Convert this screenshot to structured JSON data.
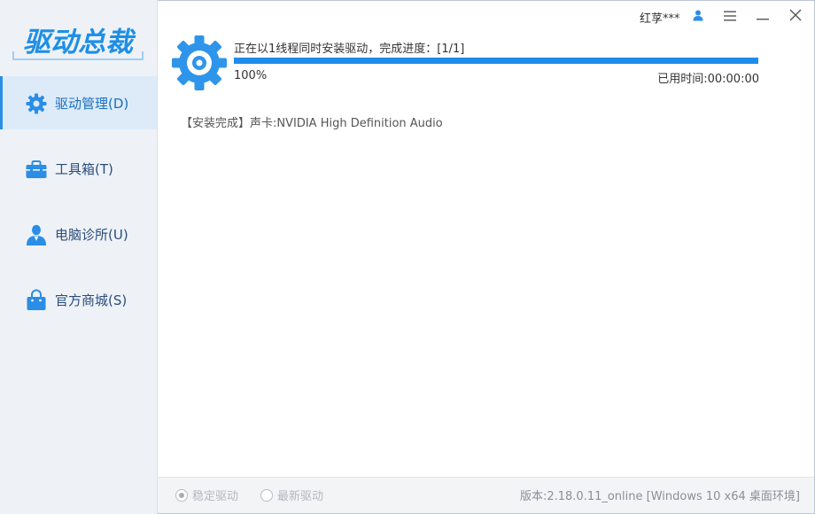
{
  "app": {
    "logo_text": "驱动总裁",
    "brand_color": "#1e8fe6",
    "accent_color": "#2a8de6"
  },
  "sidebar": {
    "items": [
      {
        "label": "驱动管理(D)",
        "icon": "gear-icon",
        "active": true
      },
      {
        "label": "工具箱(T)",
        "icon": "toolbox-icon",
        "active": false
      },
      {
        "label": "电脑诊所(U)",
        "icon": "doctor-icon",
        "active": false
      },
      {
        "label": "官方商城(S)",
        "icon": "shopping-bag-icon",
        "active": false
      }
    ]
  },
  "titlebar": {
    "user_name": "红莩***",
    "buttons": [
      "user-icon",
      "menu-icon",
      "minimize-icon",
      "close-icon"
    ]
  },
  "install": {
    "status_text": "正在以1线程同时安装驱动，完成进度：[1/1]",
    "progress_percent": 100,
    "percent_label": "100%",
    "elapsed_label": "已用时间:00:00:00",
    "log": [
      "【安装完成】声卡:NVIDIA High Definition Audio"
    ]
  },
  "footer": {
    "option_stable": "稳定驱动",
    "option_latest": "最新驱动",
    "selected": "稳定驱动",
    "version": "版本:2.18.0.11_online [Windows 10 x64 桌面环境]"
  }
}
